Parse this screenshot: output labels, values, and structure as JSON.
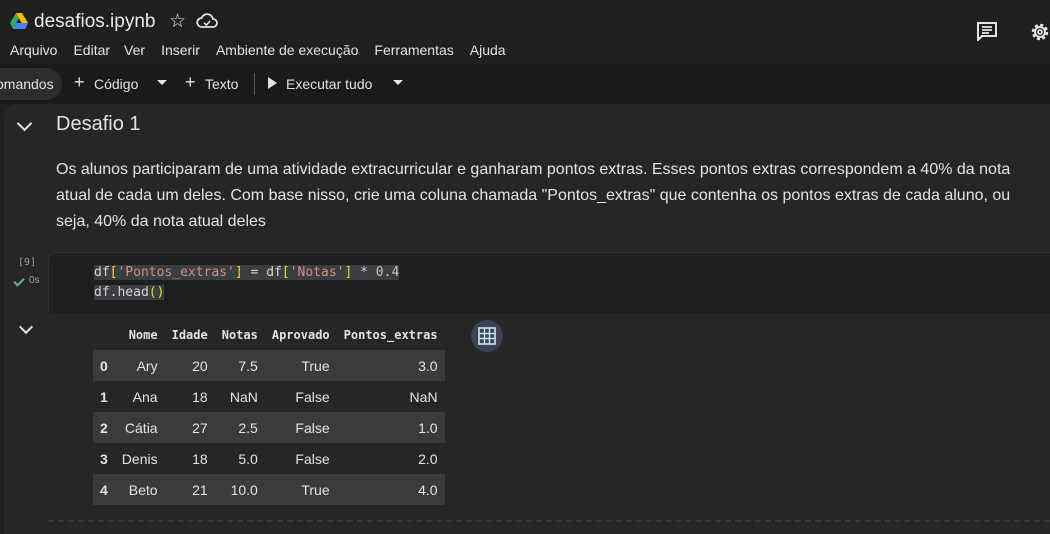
{
  "header": {
    "doc_title": "desafios.ipynb",
    "icons": {
      "logo": "drive-logo",
      "star": "star-icon",
      "cloud": "cloud-icon",
      "comment": "comment-icon",
      "settings": "gear-icon"
    }
  },
  "menu": [
    "Arquivo",
    "Editar",
    "Ver",
    "Inserir",
    "Ambiente de execução",
    "Ferramentas",
    "Ajuda"
  ],
  "toolbar": {
    "commands_label": "omandos",
    "code_label": "Código",
    "text_label": "Texto",
    "run_all_label": "Executar tudo"
  },
  "section": {
    "heading": "Desafio 1",
    "description": "Os alunos participaram de uma atividade extracurricular e ganharam pontos extras. Esses pontos extras correspondem a 40% da nota atual de cada um deles. Com base nisso, crie uma coluna chamada \"Pontos_extras\" que contenha os pontos extras de cada aluno, ou seja, 40% da nota atual deles"
  },
  "code_cell": {
    "execution_count": "[9]",
    "exec_time": "0s",
    "line1": {
      "a": "df",
      "b": "[",
      "c": "'Pontos_extras'",
      "d": "]",
      "e": " = df",
      "f": "[",
      "g": "'Notas'",
      "h": "]",
      "i": " * ",
      "j": "0.4"
    },
    "line2": {
      "a": "df.head",
      "b": "()"
    }
  },
  "output": {
    "columns": [
      "",
      "Nome",
      "Idade",
      "Notas",
      "Aprovado",
      "Pontos_extras"
    ],
    "rows": [
      [
        "0",
        "Ary",
        "20",
        "7.5",
        "True",
        "3.0"
      ],
      [
        "1",
        "Ana",
        "18",
        "NaN",
        "False",
        "NaN"
      ],
      [
        "2",
        "Cátia",
        "27",
        "2.5",
        "False",
        "1.0"
      ],
      [
        "3",
        "Denis",
        "18",
        "5.0",
        "False",
        "2.0"
      ],
      [
        "4",
        "Beto",
        "21",
        "10.0",
        "True",
        "4.0"
      ]
    ]
  },
  "colors": {
    "background": "#1f1f1f",
    "cell": "#1e1e1e",
    "string": "#ce9178",
    "number": "#b5cea8",
    "bracket": "#ffd700",
    "check": "#5bb974"
  }
}
